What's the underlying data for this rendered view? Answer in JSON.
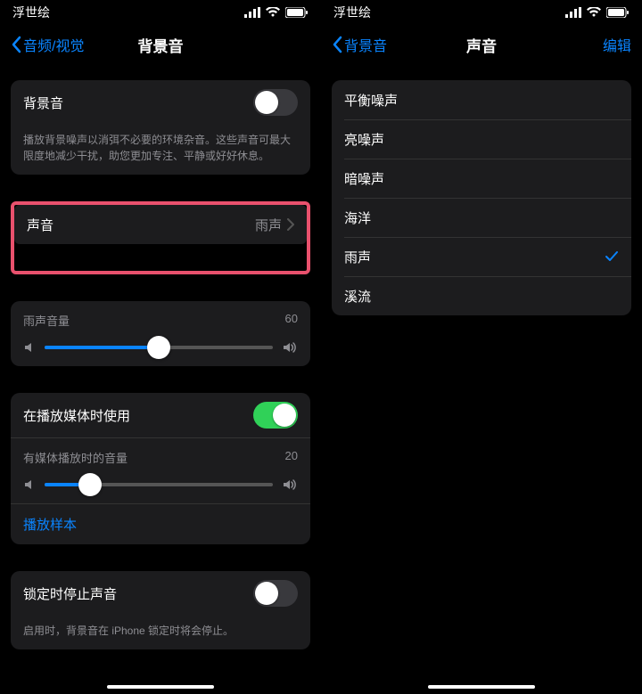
{
  "statusbar": {
    "carrier": "浮世绘"
  },
  "left": {
    "nav_back": "音频/视觉",
    "nav_title": "背景音",
    "group1": {
      "bg_label": "背景音",
      "bg_on": false,
      "footer": "播放背景噪声以消弭不必要的环境杂音。这些声音可最大限度地减少干扰，助您更加专注、平静或好好休息。"
    },
    "sound_row": {
      "label": "声音",
      "value": "雨声"
    },
    "volume1": {
      "label": "雨声音量",
      "value": "60",
      "pct": 50
    },
    "media": {
      "label": "在播放媒体时使用",
      "on": true,
      "vol_label": "有媒体播放时的音量",
      "vol_value": "20",
      "vol_pct": 20,
      "sample": "播放样本"
    },
    "lock": {
      "label": "锁定时停止声音",
      "on": false,
      "footer": "启用时，背景音在 iPhone 锁定时将会停止。"
    }
  },
  "right": {
    "nav_back": "背景音",
    "nav_title": "声音",
    "nav_edit": "编辑",
    "options": [
      "平衡噪声",
      "亮噪声",
      "暗噪声",
      "海洋",
      "雨声",
      "溪流"
    ],
    "selected_index": 4
  }
}
